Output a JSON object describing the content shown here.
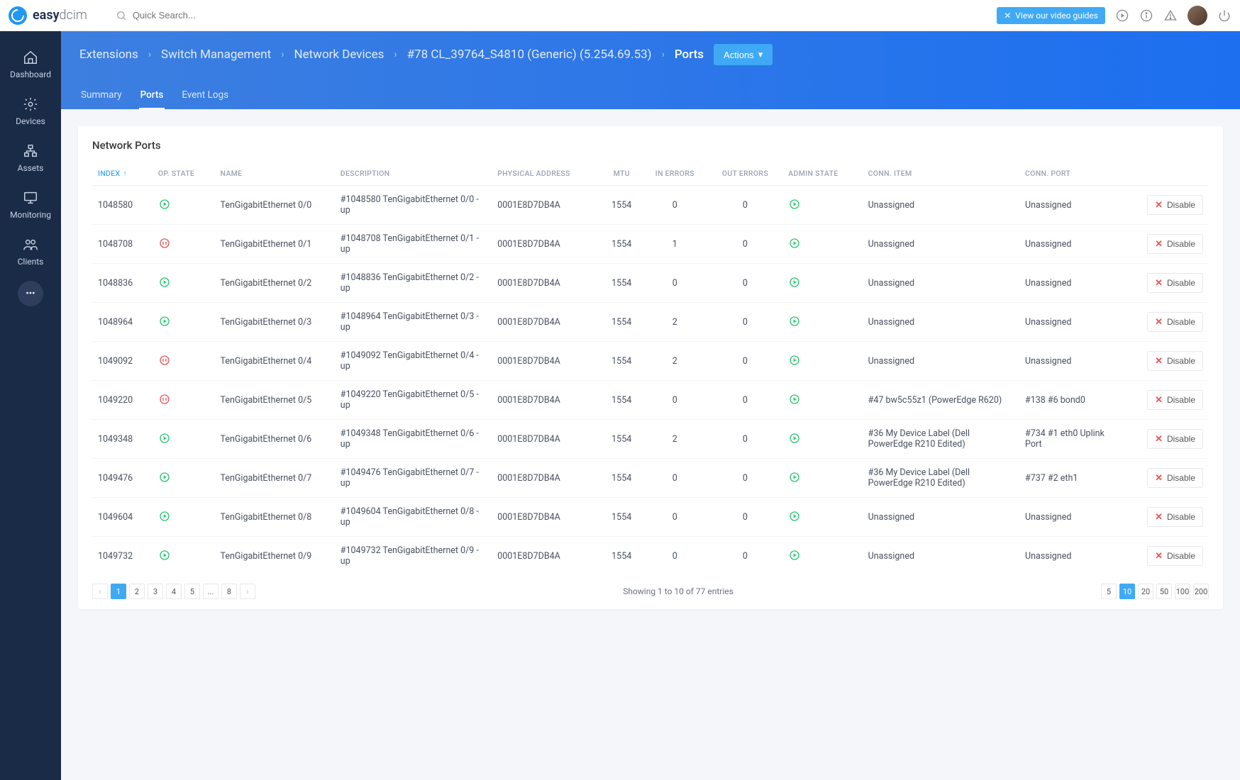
{
  "logo": {
    "bold": "easy",
    "light": "dcim"
  },
  "search": {
    "placeholder": "Quick Search..."
  },
  "top": {
    "video_guides": "View our video guides"
  },
  "sidebar": {
    "items": [
      {
        "label": "Dashboard"
      },
      {
        "label": "Devices"
      },
      {
        "label": "Assets"
      },
      {
        "label": "Monitoring"
      },
      {
        "label": "Clients"
      }
    ]
  },
  "breadcrumbs": [
    "Extensions",
    "Switch Management",
    "Network Devices",
    "#78 CL_39764_S4810 (Generic) (5.254.69.53)",
    "Ports"
  ],
  "actions_label": "Actions",
  "tabs": [
    {
      "label": "Summary",
      "active": false
    },
    {
      "label": "Ports",
      "active": true
    },
    {
      "label": "Event Logs",
      "active": false
    }
  ],
  "panel_title": "Network Ports",
  "columns": [
    "INDEX",
    "OP. STATE",
    "NAME",
    "DESCRIPTION",
    "PHYSICAL ADDRESS",
    "MTU",
    "IN ERRORS",
    "OUT ERRORS",
    "ADMIN STATE",
    "CONN. ITEM",
    "CONN. PORT",
    ""
  ],
  "rows": [
    {
      "index": "1048580",
      "op": "up",
      "name": "TenGigabitEthernet 0/0",
      "desc": "#1048580 TenGigabitEthernet 0/0 - up",
      "phys": "0001E8D7DB4A",
      "mtu": "1554",
      "inerr": "0",
      "outerr": "0",
      "admin": "up",
      "item": "Unassigned",
      "port": "Unassigned"
    },
    {
      "index": "1048708",
      "op": "down",
      "name": "TenGigabitEthernet 0/1",
      "desc": "#1048708 TenGigabitEthernet 0/1 - up",
      "phys": "0001E8D7DB4A",
      "mtu": "1554",
      "inerr": "1",
      "outerr": "0",
      "admin": "up",
      "item": "Unassigned",
      "port": "Unassigned"
    },
    {
      "index": "1048836",
      "op": "up",
      "name": "TenGigabitEthernet 0/2",
      "desc": "#1048836 TenGigabitEthernet 0/2 - up",
      "phys": "0001E8D7DB4A",
      "mtu": "1554",
      "inerr": "0",
      "outerr": "0",
      "admin": "up",
      "item": "Unassigned",
      "port": "Unassigned"
    },
    {
      "index": "1048964",
      "op": "up",
      "name": "TenGigabitEthernet 0/3",
      "desc": "#1048964 TenGigabitEthernet 0/3 - up",
      "phys": "0001E8D7DB4A",
      "mtu": "1554",
      "inerr": "2",
      "outerr": "0",
      "admin": "up",
      "item": "Unassigned",
      "port": "Unassigned"
    },
    {
      "index": "1049092",
      "op": "down",
      "name": "TenGigabitEthernet 0/4",
      "desc": "#1049092 TenGigabitEthernet 0/4 - up",
      "phys": "0001E8D7DB4A",
      "mtu": "1554",
      "inerr": "2",
      "outerr": "0",
      "admin": "up",
      "item": "Unassigned",
      "port": "Unassigned"
    },
    {
      "index": "1049220",
      "op": "down",
      "name": "TenGigabitEthernet 0/5",
      "desc": "#1049220 TenGigabitEthernet 0/5 - up",
      "phys": "0001E8D7DB4A",
      "mtu": "1554",
      "inerr": "0",
      "outerr": "0",
      "admin": "up",
      "item": "#47 bw5c55z1 (PowerEdge R620)",
      "port": "#138 #6 bond0"
    },
    {
      "index": "1049348",
      "op": "up",
      "name": "TenGigabitEthernet 0/6",
      "desc": "#1049348 TenGigabitEthernet 0/6 - up",
      "phys": "0001E8D7DB4A",
      "mtu": "1554",
      "inerr": "2",
      "outerr": "0",
      "admin": "up",
      "item": "#36 My Device Label (Dell PowerEdge R210 Edited)",
      "port": "#734 #1 eth0 Uplink Port"
    },
    {
      "index": "1049476",
      "op": "up",
      "name": "TenGigabitEthernet 0/7",
      "desc": "#1049476 TenGigabitEthernet 0/7 - up",
      "phys": "0001E8D7DB4A",
      "mtu": "1554",
      "inerr": "0",
      "outerr": "0",
      "admin": "up",
      "item": "#36 My Device Label (Dell PowerEdge R210 Edited)",
      "port": "#737 #2 eth1"
    },
    {
      "index": "1049604",
      "op": "up",
      "name": "TenGigabitEthernet 0/8",
      "desc": "#1049604 TenGigabitEthernet 0/8 - up",
      "phys": "0001E8D7DB4A",
      "mtu": "1554",
      "inerr": "0",
      "outerr": "0",
      "admin": "up",
      "item": "Unassigned",
      "port": "Unassigned"
    },
    {
      "index": "1049732",
      "op": "up",
      "name": "TenGigabitEthernet 0/9",
      "desc": "#1049732 TenGigabitEthernet 0/9 - up",
      "phys": "0001E8D7DB4A",
      "mtu": "1554",
      "inerr": "0",
      "outerr": "0",
      "admin": "up",
      "item": "Unassigned",
      "port": "Unassigned"
    }
  ],
  "disable_label": "Disable",
  "pagination": {
    "pages": [
      "1",
      "2",
      "3",
      "4",
      "5",
      "...",
      "8"
    ],
    "active": "1"
  },
  "footer_info": "Showing 1 to 10 of 77 entries",
  "page_sizes": [
    "5",
    "10",
    "20",
    "50",
    "100",
    "200"
  ],
  "page_size_active": "10"
}
